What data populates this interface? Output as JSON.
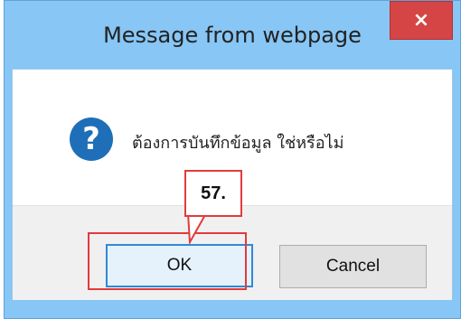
{
  "dialog": {
    "title": "Message from webpage",
    "close_label": "×",
    "message": "ต้องการบันทึกข้อมูล ใช่หรือไม่",
    "icon": "question-icon",
    "icon_glyph": "?"
  },
  "buttons": {
    "ok_label": "OK",
    "cancel_label": "Cancel"
  },
  "annotation": {
    "step_label": "57.",
    "color": "#e23b3b"
  }
}
